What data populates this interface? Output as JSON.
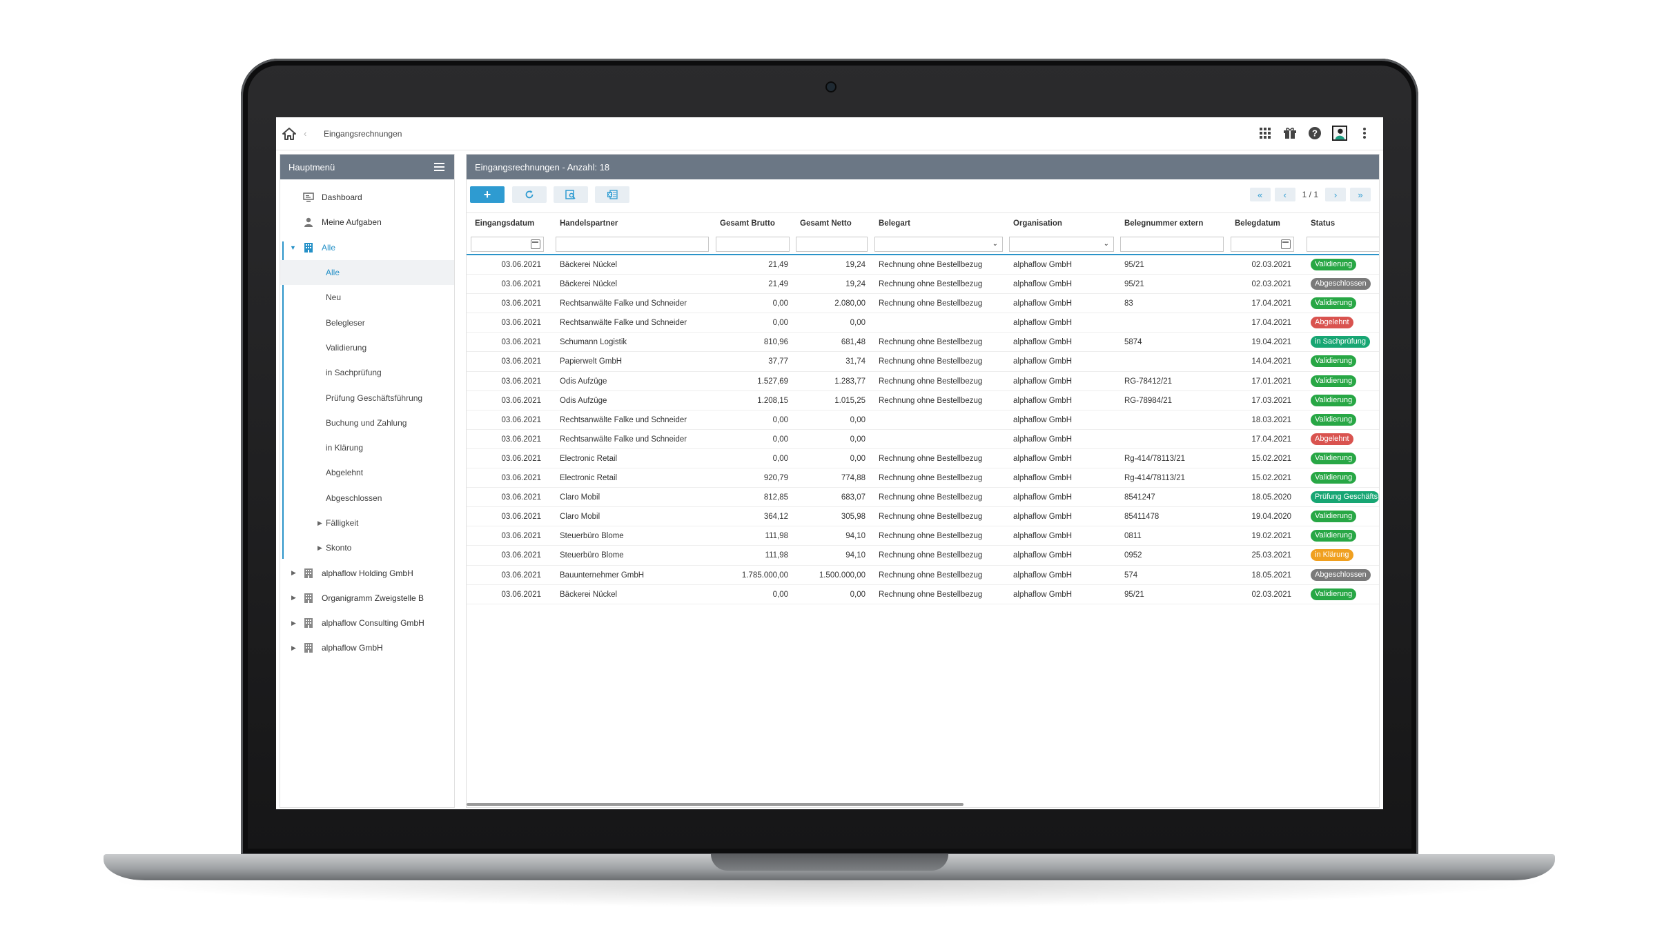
{
  "topbar": {
    "breadcrumb": "Eingangsrechnungen",
    "icons": [
      "apps-grid-icon",
      "gift-icon",
      "help-icon",
      "user-avatar",
      "more-vertical-icon"
    ]
  },
  "sidebar": {
    "title": "Hauptmenü",
    "items": [
      {
        "label": "Dashboard",
        "icon": "monitor-icon"
      },
      {
        "label": "Meine Aufgaben",
        "icon": "person-icon"
      },
      {
        "label": "Alle",
        "icon": "building-icon",
        "expanded": true
      }
    ],
    "sub_items": [
      {
        "label": "Alle",
        "active": true
      },
      {
        "label": "Neu"
      },
      {
        "label": "Belegleser"
      },
      {
        "label": "Validierung"
      },
      {
        "label": "in Sachprüfung"
      },
      {
        "label": "Prüfung Geschäftsführung"
      },
      {
        "label": "Buchung und Zahlung"
      },
      {
        "label": "in Klärung"
      },
      {
        "label": "Abgelehnt"
      },
      {
        "label": "Abgeschlossen"
      },
      {
        "label": "Fälligkeit",
        "collapsed": true
      },
      {
        "label": "Skonto",
        "collapsed": true
      }
    ],
    "orgs": [
      {
        "label": "alphaflow Holding GmbH"
      },
      {
        "label": "Organigramm Zweigstelle B"
      },
      {
        "label": "alphaflow Consulting GmbH"
      },
      {
        "label": "alphaflow GmbH"
      }
    ]
  },
  "main": {
    "title": "Eingangsrechnungen - Anzahl: 18",
    "toolbar": {
      "add_label": "+",
      "pager_info": "1 / 1",
      "pager_first": "«",
      "pager_prev": "‹",
      "pager_next": "›",
      "pager_last": "»"
    },
    "columns": [
      "Eingangsdatum",
      "Handelspartner",
      "Gesamt Brutto",
      "Gesamt Netto",
      "Belegart",
      "Organisation",
      "Belegnummer extern",
      "Belegdatum",
      "Status"
    ],
    "status_colors": {
      "Validierung": "#28a745",
      "Abgeschlossen": "#7a7a7a",
      "Abgelehnt": "#d9534f",
      "in Sachprüfung": "#17a673",
      "Prüfung Geschäftsführung": "#17a673",
      "in Klärung": "#f0a020"
    },
    "rows": [
      {
        "eingang": "03.06.2021",
        "partner": "Bäckerei Nückel",
        "brutto": "21,49",
        "netto": "19,24",
        "belegart": "Rechnung ohne Bestellbezug",
        "org": "alphaflow GmbH",
        "nr": "95/21",
        "datum": "02.03.2021",
        "status": "Validierung"
      },
      {
        "eingang": "03.06.2021",
        "partner": "Bäckerei Nückel",
        "brutto": "21,49",
        "netto": "19,24",
        "belegart": "Rechnung ohne Bestellbezug",
        "org": "alphaflow GmbH",
        "nr": "95/21",
        "datum": "02.03.2021",
        "status": "Abgeschlossen"
      },
      {
        "eingang": "03.06.2021",
        "partner": "Rechtsanwälte Falke und Schneider",
        "brutto": "0,00",
        "netto": "2.080,00",
        "belegart": "Rechnung ohne Bestellbezug",
        "org": "alphaflow GmbH",
        "nr": "83",
        "datum": "17.04.2021",
        "status": "Validierung"
      },
      {
        "eingang": "03.06.2021",
        "partner": "Rechtsanwälte Falke und Schneider",
        "brutto": "0,00",
        "netto": "0,00",
        "belegart": "",
        "org": "alphaflow GmbH",
        "nr": "",
        "datum": "17.04.2021",
        "status": "Abgelehnt"
      },
      {
        "eingang": "03.06.2021",
        "partner": "Schumann Logistik",
        "brutto": "810,96",
        "netto": "681,48",
        "belegart": "Rechnung ohne Bestellbezug",
        "org": "alphaflow GmbH",
        "nr": "5874",
        "datum": "19.04.2021",
        "status": "in Sachprüfung"
      },
      {
        "eingang": "03.06.2021",
        "partner": "Papierwelt GmbH",
        "brutto": "37,77",
        "netto": "31,74",
        "belegart": "Rechnung ohne Bestellbezug",
        "org": "alphaflow GmbH",
        "nr": "",
        "datum": "14.04.2021",
        "status": "Validierung"
      },
      {
        "eingang": "03.06.2021",
        "partner": "Odis Aufzüge",
        "brutto": "1.527,69",
        "netto": "1.283,77",
        "belegart": "Rechnung ohne Bestellbezug",
        "org": "alphaflow GmbH",
        "nr": "RG-78412/21",
        "datum": "17.01.2021",
        "status": "Validierung"
      },
      {
        "eingang": "03.06.2021",
        "partner": "Odis Aufzüge",
        "brutto": "1.208,15",
        "netto": "1.015,25",
        "belegart": "Rechnung ohne Bestellbezug",
        "org": "alphaflow GmbH",
        "nr": "RG-78984/21",
        "datum": "17.03.2021",
        "status": "Validierung"
      },
      {
        "eingang": "03.06.2021",
        "partner": "Rechtsanwälte Falke und Schneider",
        "brutto": "0,00",
        "netto": "0,00",
        "belegart": "",
        "org": "alphaflow GmbH",
        "nr": "",
        "datum": "18.03.2021",
        "status": "Validierung"
      },
      {
        "eingang": "03.06.2021",
        "partner": "Rechtsanwälte Falke und Schneider",
        "brutto": "0,00",
        "netto": "0,00",
        "belegart": "",
        "org": "alphaflow GmbH",
        "nr": "",
        "datum": "17.04.2021",
        "status": "Abgelehnt"
      },
      {
        "eingang": "03.06.2021",
        "partner": "Electronic Retail",
        "brutto": "0,00",
        "netto": "0,00",
        "belegart": "Rechnung ohne Bestellbezug",
        "org": "alphaflow GmbH",
        "nr": "Rg-414/78113/21",
        "datum": "15.02.2021",
        "status": "Validierung"
      },
      {
        "eingang": "03.06.2021",
        "partner": "Electronic Retail",
        "brutto": "920,79",
        "netto": "774,88",
        "belegart": "Rechnung ohne Bestellbezug",
        "org": "alphaflow GmbH",
        "nr": "Rg-414/78113/21",
        "datum": "15.02.2021",
        "status": "Validierung"
      },
      {
        "eingang": "03.06.2021",
        "partner": "Claro Mobil",
        "brutto": "812,85",
        "netto": "683,07",
        "belegart": "Rechnung ohne Bestellbezug",
        "org": "alphaflow GmbH",
        "nr": "8541247",
        "datum": "18.05.2020",
        "status": "Prüfung Geschäftsführung"
      },
      {
        "eingang": "03.06.2021",
        "partner": "Claro Mobil",
        "brutto": "364,12",
        "netto": "305,98",
        "belegart": "Rechnung ohne Bestellbezug",
        "org": "alphaflow GmbH",
        "nr": "85411478",
        "datum": "19.04.2020",
        "status": "Validierung"
      },
      {
        "eingang": "03.06.2021",
        "partner": "Steuerbüro Blome",
        "brutto": "111,98",
        "netto": "94,10",
        "belegart": "Rechnung ohne Bestellbezug",
        "org": "alphaflow GmbH",
        "nr": "0811",
        "datum": "19.02.2021",
        "status": "Validierung"
      },
      {
        "eingang": "03.06.2021",
        "partner": "Steuerbüro Blome",
        "brutto": "111,98",
        "netto": "94,10",
        "belegart": "Rechnung ohne Bestellbezug",
        "org": "alphaflow GmbH",
        "nr": "0952",
        "datum": "25.03.2021",
        "status": "in Klärung"
      },
      {
        "eingang": "03.06.2021",
        "partner": "Bauunternehmer GmbH",
        "brutto": "1.785.000,00",
        "netto": "1.500.000,00",
        "belegart": "Rechnung ohne Bestellbezug",
        "org": "alphaflow GmbH",
        "nr": "574",
        "datum": "18.05.2021",
        "status": "Abgeschlossen"
      },
      {
        "eingang": "03.06.2021",
        "partner": "Bäckerei Nückel",
        "brutto": "0,00",
        "netto": "0,00",
        "belegart": "Rechnung ohne Bestellbezug",
        "org": "alphaflow GmbH",
        "nr": "95/21",
        "datum": "02.03.2021",
        "status": "Validierung"
      }
    ]
  }
}
